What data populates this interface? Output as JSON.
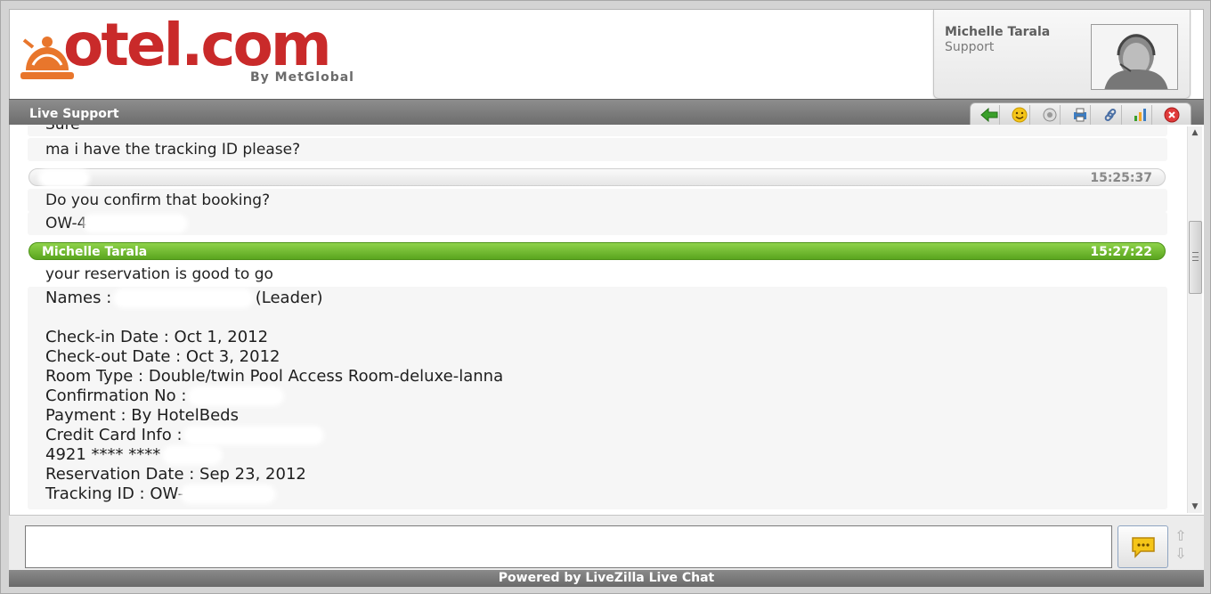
{
  "brand": {
    "logo_text": "otel.com",
    "logo_sub": "By MetGlobal"
  },
  "agent": {
    "name": "Michelle Tarala",
    "role": "Support"
  },
  "titlebar": {
    "title": "Live Support"
  },
  "toolbar": {
    "icons": [
      "back-arrow-icon",
      "smiley-icon",
      "sound-icon",
      "print-icon",
      "link-icon",
      "chart-icon",
      "close-icon"
    ]
  },
  "chat": {
    "line_top_partial": "Sure",
    "line_tracking_request": "ma i have the tracking ID please?",
    "visitor_time": "15:25:37",
    "line_confirm": "Do you confirm that booking?",
    "line_booking_id": "OW-4",
    "agent_name": "Michelle Tarala",
    "agent_time": "15:27:22",
    "line_reservation_ok": "your reservation is good to go",
    "details": {
      "names_label": "Names : ",
      "names_suffix": "(Leader)",
      "checkin": "Check-in Date : Oct 1, 2012",
      "checkout": "Check-out Date : Oct 3, 2012",
      "room_type": "Room Type : Double/twin Pool Access Room-deluxe-lanna",
      "confirmation_label": "Confirmation No : ",
      "payment": "Payment : By HotelBeds",
      "credit_label": "Credit Card Info : ",
      "card_number": "4921 **** **** ",
      "reservation_date": "Reservation Date : Sep 23, 2012",
      "tracking_label": "Tracking ID : OW-"
    }
  },
  "input": {
    "placeholder": ""
  },
  "footer": {
    "text": "Powered by LiveZilla Live Chat"
  },
  "colors": {
    "brand_red": "#c92a2a",
    "brand_orange": "#e8762c",
    "agent_green": "#5aa51e"
  }
}
